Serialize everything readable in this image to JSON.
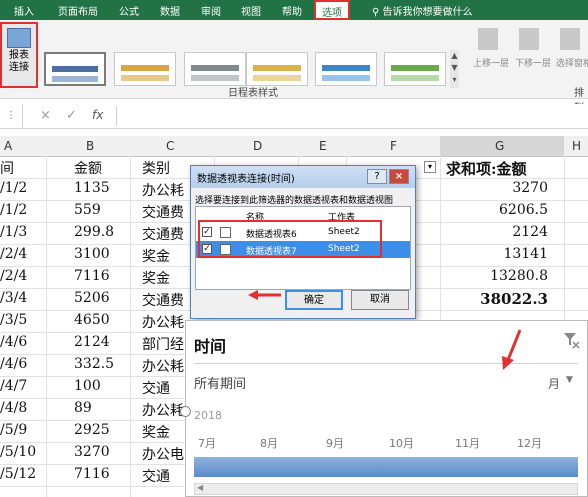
{
  "ribbon": {
    "tabs": [
      "插入",
      "页面布局",
      "公式",
      "数据",
      "审阅",
      "视图",
      "帮助",
      "选项"
    ],
    "tell_me": "告诉我你想要做什么",
    "report_connections": [
      "报表",
      "连接"
    ],
    "group_label": "日程表样式",
    "layout_label": "排列",
    "arrange_buttons": [
      "上移一层",
      "下移一层",
      "选择窗格"
    ]
  },
  "formula_bar": {
    "cancel": "×",
    "confirm": "✓",
    "fx": "fx"
  },
  "columns": [
    "A",
    "B",
    "C",
    "D",
    "E",
    "F",
    "G",
    "H"
  ],
  "sheet": {
    "header": {
      "a": "间",
      "b": "金额",
      "c": "类别",
      "g": "求和项:金额"
    },
    "rows": [
      {
        "a": "/1/2",
        "b": "1135",
        "c": "办公耗",
        "g": "3270"
      },
      {
        "a": "/1/2",
        "b": "559",
        "c": "交通费",
        "g": "6206.5"
      },
      {
        "a": "/1/3",
        "b": "299.8",
        "c": "交通费",
        "g": "2124"
      },
      {
        "a": "/2/4",
        "b": "3100",
        "c": "奖金",
        "g": "13141"
      },
      {
        "a": "/2/4",
        "b": "7116",
        "c": "奖金",
        "g": "13280.8"
      },
      {
        "a": "/3/4",
        "b": "5206",
        "c": "交通费",
        "g": "38022.3"
      },
      {
        "a": "/3/5",
        "b": "4650",
        "c": "办公耗",
        "g": ""
      },
      {
        "a": "/4/6",
        "b": "2124",
        "c": "部门经",
        "g": ""
      },
      {
        "a": "/4/6",
        "b": "332.5",
        "c": "办公耗",
        "g": ""
      },
      {
        "a": "/4/7",
        "b": "100",
        "c": "交通",
        "g": ""
      },
      {
        "a": "/4/8",
        "b": "89",
        "c": "办公耗",
        "g": ""
      },
      {
        "a": "/5/9",
        "b": "2925",
        "c": "奖金",
        "g": ""
      },
      {
        "a": "/5/10",
        "b": "3270",
        "c": "办公电",
        "g": ""
      },
      {
        "a": "/5/12",
        "b": "7116",
        "c": "交通",
        "g": ""
      }
    ]
  },
  "dialog": {
    "title": "数据透视表连接(时间)",
    "help": "?",
    "close": "×",
    "description": "选择要连接到此筛选器的数据透视表和数据透视图",
    "col_name": "名称",
    "col_sheet": "工作表",
    "items": [
      {
        "name": "数据透视表6",
        "sheet": "Sheet2",
        "checked": true
      },
      {
        "name": "数据透视表7",
        "sheet": "Sheet2",
        "checked": true
      }
    ],
    "ok": "确定",
    "cancel": "取消"
  },
  "slicer": {
    "title": "时间",
    "period": "所有期间",
    "level": "月",
    "year": "2018",
    "months": [
      "7月",
      "8月",
      "9月",
      "10月",
      "11月",
      "12月"
    ]
  },
  "colors": {
    "excel_green": "#217346",
    "highlight_red": "#e03030",
    "selection_blue": "#3c8ee8"
  }
}
